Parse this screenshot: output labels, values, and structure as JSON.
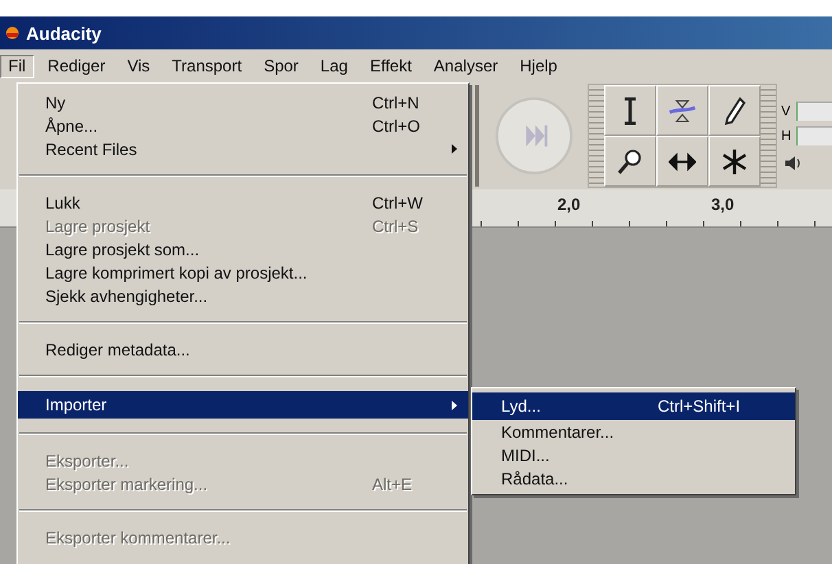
{
  "window": {
    "title": "Audacity"
  },
  "menubar": [
    {
      "label": "Fil",
      "selected": true
    },
    {
      "label": "Rediger",
      "selected": false
    },
    {
      "label": "Vis",
      "selected": false
    },
    {
      "label": "Transport",
      "selected": false
    },
    {
      "label": "Spor",
      "selected": false
    },
    {
      "label": "Lag",
      "selected": false
    },
    {
      "label": "Effekt",
      "selected": false
    },
    {
      "label": "Analyser",
      "selected": false
    },
    {
      "label": "Hjelp",
      "selected": false
    }
  ],
  "file_menu": {
    "items": [
      {
        "kind": "item",
        "label": "Ny",
        "shortcut": "Ctrl+N",
        "disabled": false,
        "selected": false,
        "submenu": false
      },
      {
        "kind": "item",
        "label": "Åpne...",
        "shortcut": "Ctrl+O",
        "disabled": false,
        "selected": false,
        "submenu": false
      },
      {
        "kind": "item",
        "label": "Recent Files",
        "disabled": false,
        "selected": false,
        "submenu": true
      },
      {
        "kind": "separator"
      },
      {
        "kind": "item",
        "label": "Lukk",
        "shortcut": "Ctrl+W",
        "disabled": false,
        "selected": false,
        "submenu": false
      },
      {
        "kind": "item",
        "label": "Lagre prosjekt",
        "shortcut": "Ctrl+S",
        "disabled": true,
        "selected": false,
        "submenu": false
      },
      {
        "kind": "item",
        "label": "Lagre prosjekt som...",
        "disabled": false,
        "selected": false,
        "submenu": false
      },
      {
        "kind": "item",
        "label": "Lagre komprimert kopi av prosjekt...",
        "disabled": false,
        "selected": false,
        "submenu": false
      },
      {
        "kind": "item",
        "label": "Sjekk avhengigheter...",
        "disabled": false,
        "selected": false,
        "submenu": false
      },
      {
        "kind": "separator"
      },
      {
        "kind": "item",
        "label": "Rediger metadata...",
        "disabled": false,
        "selected": false,
        "submenu": false
      },
      {
        "kind": "separator"
      },
      {
        "kind": "item",
        "label": "Importer",
        "disabled": false,
        "selected": true,
        "submenu": true
      },
      {
        "kind": "separator"
      },
      {
        "kind": "item",
        "label": "Eksporter...",
        "disabled": true,
        "selected": false,
        "submenu": false
      },
      {
        "kind": "item",
        "label": "Eksporter markering...",
        "shortcut": "Alt+E",
        "disabled": true,
        "selected": false,
        "submenu": false
      },
      {
        "kind": "separator"
      },
      {
        "kind": "item",
        "label": "Eksporter kommentarer...",
        "disabled": true,
        "selected": false,
        "submenu": false
      }
    ]
  },
  "import_submenu": {
    "items": [
      {
        "label": "Lyd...",
        "shortcut": "Ctrl+Shift+I",
        "selected": true
      },
      {
        "label": "Kommentarer...",
        "selected": false
      },
      {
        "label": "MIDI...",
        "selected": false
      },
      {
        "label": "Rådata...",
        "selected": false
      }
    ]
  },
  "meter": {
    "labels": [
      "V",
      "H"
    ]
  },
  "ruler": {
    "labels": [
      "2,0",
      "3,0"
    ]
  }
}
